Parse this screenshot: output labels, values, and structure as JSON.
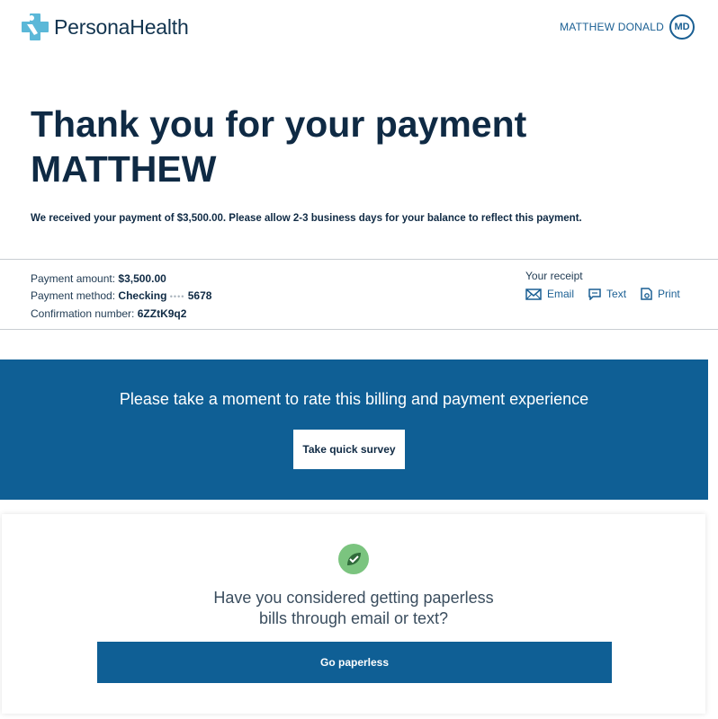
{
  "header": {
    "logo_text_light": "Persona",
    "logo_text_bold": "Health",
    "user_name": "MATTHEW DONALD",
    "user_initials": "MD"
  },
  "confirmation": {
    "title_line1": "Thank you for your payment",
    "title_line2": "MATTHEW",
    "message": "We received your payment of $3,500.00. Please allow 2-3 business days for your balance to reflect this payment."
  },
  "details": {
    "amount_label": "Payment amount:",
    "amount_value": "$3,500.00",
    "method_label": "Payment method:",
    "method_value": "Checking",
    "method_mask": "••••",
    "method_last4": "5678",
    "confirmation_label": "Confirmation number:",
    "confirmation_value": "6ZZtK9q2"
  },
  "receipt": {
    "label": "Your receipt",
    "email_label": "Email",
    "text_label": "Text",
    "print_label": "Print"
  },
  "survey": {
    "prompt": "Please take a moment to rate this billing and payment experience",
    "button_label": "Take quick survey"
  },
  "paperless": {
    "icon": "leaf-check-icon",
    "question_line1": "Have you considered getting paperless",
    "question_line2": "bills through email or text?",
    "button_label": "Go paperless"
  },
  "colors": {
    "brand_blue": "#0f5f95",
    "navy_text": "#0f2a44",
    "link_blue": "#1a5f93",
    "logo_cyan": "#5bb8d8",
    "leaf_green": "#7bc47f"
  }
}
